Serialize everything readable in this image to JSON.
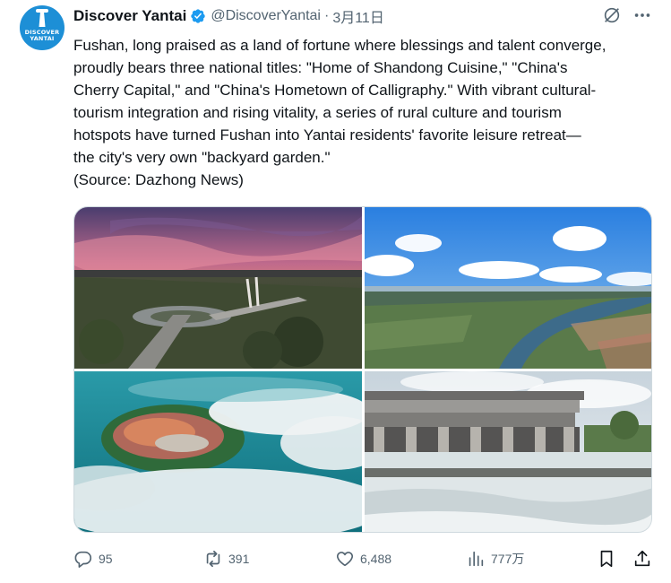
{
  "tweet": {
    "author": {
      "display_name": "Discover Yantai",
      "handle": "@DiscoverYantai",
      "avatar_text_line1": "DISCOVER",
      "avatar_text_line2": "YANTAI",
      "verified": true
    },
    "separator": "·",
    "timestamp": "3月11日",
    "text_lines": [
      "Fushan, long praised as a land of fortune where blessings and talent converge,",
      "proudly bears three national titles: \"Home of Shandong Cuisine,\" \"China's",
      "Cherry Capital,\" and \"China's Hometown of Calligraphy.\" With vibrant cultural-",
      "tourism integration and rising vitality, a series of rural culture and tourism",
      "hotspots have turned Fushan into Yantai residents' favorite leisure retreat—",
      "the city's very own \"backyard garden.\"",
      "(Source: Dazhong News)"
    ],
    "media": [
      {
        "subject": "sunset-town-bridge"
      },
      {
        "subject": "river-valley-blue-sky"
      },
      {
        "subject": "village-in-clouds"
      },
      {
        "subject": "dam-spillway"
      }
    ],
    "actions": {
      "replies": "95",
      "reposts": "391",
      "likes": "6,488",
      "views": "777万"
    }
  },
  "colors": {
    "text_primary": "#0f1419",
    "text_secondary": "#536471",
    "verified_blue": "#1d9bf0",
    "avatar_blue": "#1d8fd6",
    "border": "#cfd9de"
  },
  "icons": {
    "grok": "grok-icon",
    "more": "more-icon",
    "reply": "reply-icon",
    "repost": "repost-icon",
    "like": "heart-icon",
    "views": "views-icon",
    "bookmark": "bookmark-icon",
    "share": "share-icon",
    "verified": "verified-badge-icon"
  }
}
